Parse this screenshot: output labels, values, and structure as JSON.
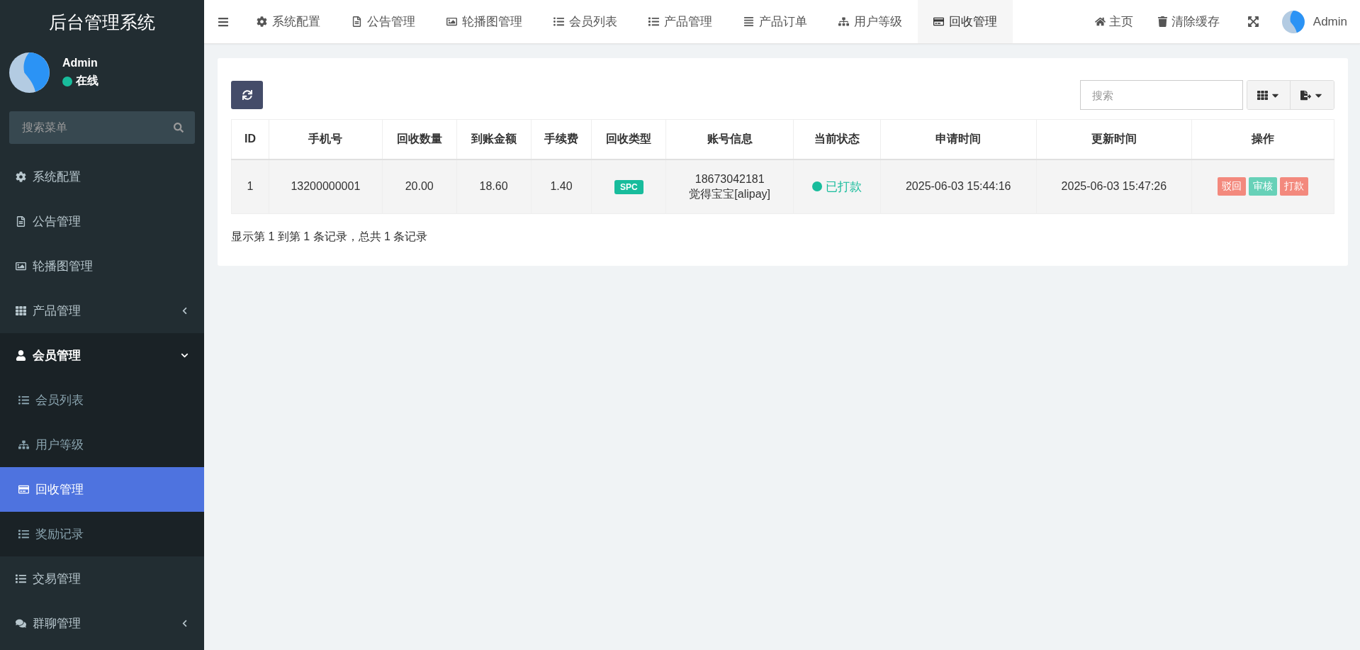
{
  "sidebar": {
    "title": "后台管理系统",
    "user": {
      "name": "Admin",
      "status": {
        "label": "在线",
        "color": "#18bc9c"
      }
    },
    "search": {
      "placeholder": "搜索菜单"
    },
    "items": [
      {
        "label": "系统配置",
        "kind": "link",
        "selected": false
      },
      {
        "label": "公告管理",
        "kind": "link",
        "selected": false
      },
      {
        "label": "轮播图管理",
        "kind": "link",
        "selected": false
      },
      {
        "label": "产品管理",
        "kind": "group",
        "expanded": false
      },
      {
        "label": "会员管理",
        "kind": "group",
        "expanded": true,
        "children": [
          {
            "label": "会员列表",
            "selected": false
          },
          {
            "label": "用户等级",
            "selected": false
          },
          {
            "label": "回收管理",
            "selected": true
          },
          {
            "label": "奖励记录",
            "selected": false
          }
        ]
      },
      {
        "label": "交易管理",
        "kind": "link",
        "selected": false
      },
      {
        "label": "群聊管理",
        "kind": "group",
        "expanded": false
      }
    ]
  },
  "topbar": {
    "tabs": [
      {
        "label": "系统配置",
        "selected": false
      },
      {
        "label": "公告管理",
        "selected": false
      },
      {
        "label": "轮播图管理",
        "selected": false
      },
      {
        "label": "会员列表",
        "selected": false
      },
      {
        "label": "产品管理",
        "selected": false
      },
      {
        "label": "产品订单",
        "selected": false
      },
      {
        "label": "用户等级",
        "selected": false
      },
      {
        "label": "回收管理",
        "selected": true
      }
    ],
    "links": [
      "主页",
      "清除缓存"
    ],
    "user": {
      "name": "Admin"
    }
  },
  "toolbar": {
    "search": {
      "placeholder": "搜索"
    }
  },
  "table": {
    "columns": [
      "ID",
      "手机号",
      "回收数量",
      "到账金额",
      "手续费",
      "回收类型",
      "账号信息",
      "当前状态",
      "申请时间",
      "更新时间",
      "操作"
    ],
    "rows": [
      {
        "id": "1",
        "phone": "13200000001",
        "quantity": "20.00",
        "received": "18.60",
        "fee": "1.40",
        "type": "SPC",
        "account": [
          "18673042181",
          "觉得宝宝[alipay]"
        ],
        "status": {
          "label": "已打款",
          "color": "#18bc9c"
        },
        "applied": "2025-06-03 15:44:16",
        "updated": "2025-06-03 15:47:26",
        "actions": [
          {
            "label": "驳回",
            "color": "#f3897d"
          },
          {
            "label": "审核",
            "color": "#67d1b8"
          },
          {
            "label": "打款",
            "color": "#f3897d"
          }
        ]
      }
    ]
  },
  "pagination": {
    "summary": "显示第 1 到第 1 条记录，总共 1 条记录"
  }
}
